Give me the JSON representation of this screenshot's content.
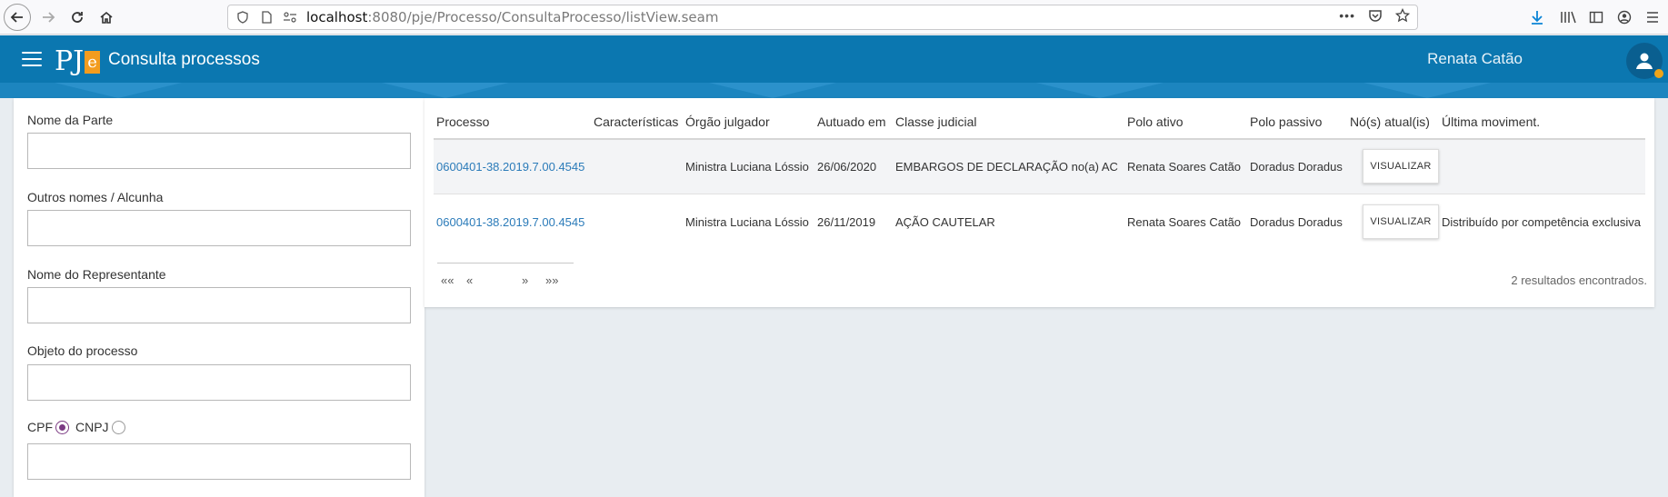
{
  "browser": {
    "url_host": "localhost",
    "url_rest": ":8080/pje/Processo/ConsultaProcesso/listView.seam",
    "url_actions": "•••"
  },
  "header": {
    "logo_text": "PJ",
    "logo_accent": "e",
    "title": "Consulta processos",
    "user_name": "Renata Catão",
    "brand_color": "#0b77b0",
    "accent_color": "#f39c1e"
  },
  "filters": {
    "nome_parte_label": "Nome da Parte",
    "outros_nomes_label": "Outros nomes / Alcunha",
    "representante_label": "Nome do Representante",
    "objeto_label": "Objeto do processo",
    "cpf_label": "CPF",
    "cnpj_label": "CNPJ",
    "selected_doc_type": "CPF"
  },
  "table": {
    "headers": [
      "Processo",
      "Características",
      "Órgão julgador",
      "Autuado em",
      "Classe judicial",
      "Polo ativo",
      "Polo passivo",
      "Nó(s) atual(is)",
      "Última moviment."
    ],
    "rows": [
      {
        "processo": "0600401-38.2019.7.00.4545",
        "caracteristicas": "",
        "orgao": "Ministra Luciana Lóssio",
        "autuado": "26/06/2020",
        "classe": "EMBARGOS DE DECLARAÇÃO no(a) AC",
        "polo_ativo": "Renata Soares Catão",
        "polo_passivo": "Doradus Doradus",
        "no_atual": "VISUALIZAR",
        "ultima": ""
      },
      {
        "processo": "0600401-38.2019.7.00.4545",
        "caracteristicas": "",
        "orgao": "Ministra Luciana Lóssio",
        "autuado": "26/11/2019",
        "classe": "AÇÃO CAUTELAR",
        "polo_ativo": "Renata Soares Catão",
        "polo_passivo": "Doradus Doradus",
        "no_atual": "VISUALIZAR",
        "ultima": "Distribuído por competência exclusiva"
      }
    ]
  },
  "pager": {
    "first": "««",
    "prev": "«",
    "next": "»",
    "last": "»»"
  },
  "result_count": "2 resultados encontrados."
}
